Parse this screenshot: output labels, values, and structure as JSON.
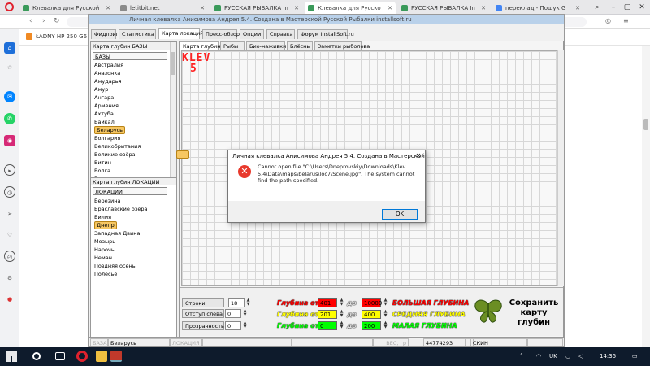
{
  "browser": {
    "tabs": [
      {
        "label": "Клевалка для Русской",
        "color": "#3a9a5a",
        "active": false
      },
      {
        "label": "letitbit.net",
        "color": "#8a8a8a",
        "active": false
      },
      {
        "label": "РУССКАЯ РЫБАЛКА In",
        "color": "#3a9a5a",
        "active": false
      },
      {
        "label": "Клевалка для Русско",
        "color": "#3a9a5a",
        "active": true
      },
      {
        "label": "РУССКАЯ РЫБАЛКА In",
        "color": "#3a9a5a",
        "active": false
      },
      {
        "label": "переклад - Пошук G",
        "color": "#4285f4",
        "active": false
      }
    ],
    "bookmark": "ŁADNY HP 250 G6 ..."
  },
  "app": {
    "title": "Личная клевалка Анисимова Андрея 5.4. Создана в Мастерской Русской Рыбалки installsoft.ru",
    "menu": [
      "Фидпоиги",
      "Статистика",
      "Карта локаций",
      "Пресс-обзор",
      "Опции",
      "Справка",
      "Форум InstallSoft.ru"
    ],
    "menu_selected": 2,
    "left": {
      "bases_title": "Карта глубин БАЗЫ",
      "bases_header": "БАЗЫ",
      "bases": [
        "Австралия",
        "Аназонка",
        "Амударья",
        "Амур",
        "Ангара",
        "Армения",
        "Ахтуба",
        "Байкал",
        "Беларусь",
        "Болгария",
        "Великобритания",
        "Великие озёра",
        "Витин",
        "Волга",
        "Вороне"
      ],
      "bases_selected": 8,
      "loc_title": "Карта глубин ЛОКАЦИИ",
      "loc_header": "ЛОКАЦИИ",
      "locations": [
        "Березина",
        "Браславские озёра",
        "Вилия",
        "Днепр",
        "Западная  Двина",
        "Мозырь",
        "Нарочь",
        "Неман",
        "Поздняя осень",
        "Полесье"
      ],
      "loc_selected": 3
    },
    "subtabs": [
      "Карта глубин",
      "Рыбы",
      "Био-наживки",
      "Блёсны",
      "Заметки рыболова"
    ],
    "subtab_selected": 0,
    "logo": {
      "line1": "KLEV",
      "line2": "5"
    },
    "controls": {
      "rows_label": "Строки",
      "rows_value": "18",
      "offset_label": "Отступ слева",
      "offset_value": "0",
      "opacity_label": "Прозрачность",
      "opacity_value": "0"
    },
    "depth": [
      {
        "from_label": "Глубина от",
        "from": "401",
        "to_label": "до",
        "to": "10000",
        "name": "БОЛЬШАЯ ГЛУБИНА",
        "color": "#ff0000"
      },
      {
        "from_label": "Глубина от",
        "from": "201",
        "to_label": "до",
        "to": "400",
        "name": "СРЕДНЯЯ ГЛУБИНА",
        "color": "#ffff00"
      },
      {
        "from_label": "Глубина от",
        "from": "0",
        "to_label": "до",
        "to": "200",
        "name": "МАЛАЯ ГЛУБИНА",
        "color": "#00ff00"
      }
    ],
    "save_label": "Сохранить карту глубин",
    "status": {
      "base_label": "БАЗА",
      "base_value": "Беларусь",
      "loc_label": "ЛОКАЦИЯ",
      "ves_label": "ВЕС, гр",
      "number": "44774293",
      "skin": "СКИН"
    }
  },
  "dialog": {
    "title": "Личная клевалка Анисимова Андрея 5.4. Создана в Мастерской Р...",
    "message": "Cannot open file \"C:\\Users\\Dneprovskiy\\Downloads\\Klev 5.4\\Data\\maps\\belarus\\loc7\\Scene.jpg\". The system cannot find the path specified.",
    "ok": "OK"
  },
  "taskbar": {
    "lang": "UK",
    "time": "14:35"
  }
}
